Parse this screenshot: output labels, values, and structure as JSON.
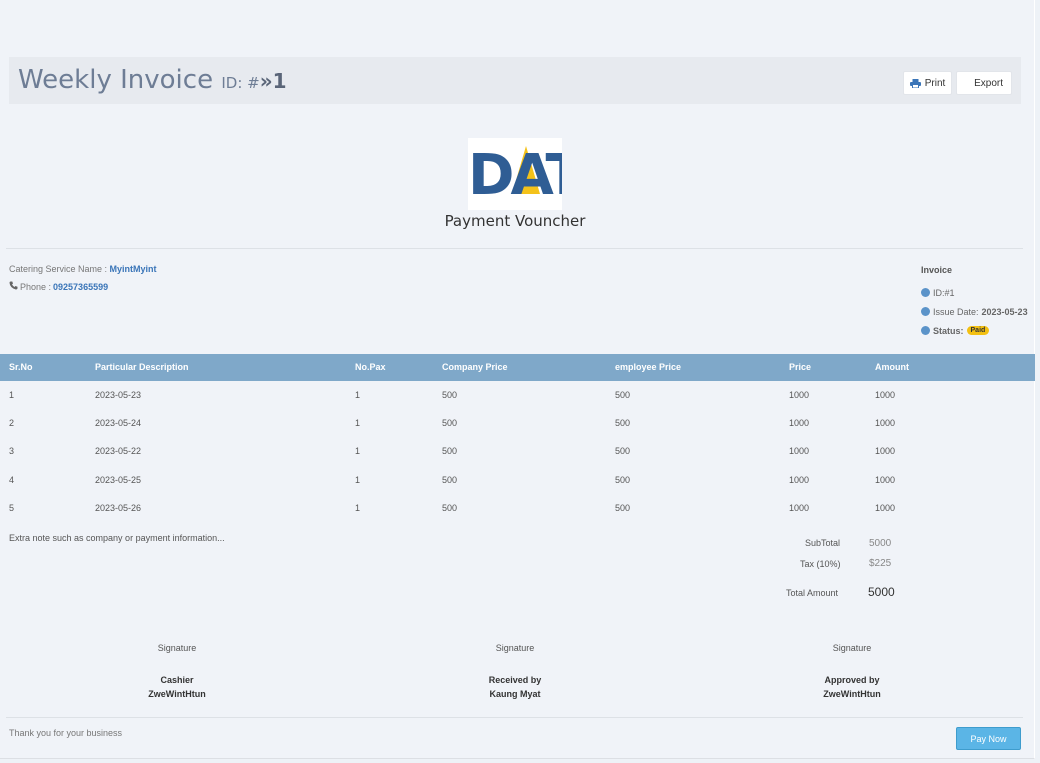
{
  "header": {
    "title": "Weekly Invoice",
    "id_label": "ID: #",
    "id_glyph": "»",
    "id_value": "1",
    "print_label": "Print",
    "export_label": "Export"
  },
  "logo": {
    "text_left": "D",
    "text_mid": "A",
    "text_right": "T",
    "colors": {
      "blue": "#2f5d94",
      "yellow": "#f4c21a"
    }
  },
  "voucher_title": "Payment Vouncher",
  "caterer": {
    "name_label": "Catering Service Name : ",
    "name": "MyintMyint",
    "phone_label": "Phone : ",
    "phone": "09257365599"
  },
  "invoice": {
    "title": "Invoice",
    "id": "ID:#1",
    "issue_label": "Issue Date: ",
    "issue_date": "2023-05-23",
    "status_label": "Status:",
    "status": "Paid"
  },
  "table": {
    "headers": [
      "Sr.No",
      "Particular Description",
      "No.Pax",
      "Company Price",
      "employee Price",
      "Price",
      "Amount"
    ],
    "rows": [
      [
        "1",
        "2023-05-23",
        "1",
        "500",
        "500",
        "1000",
        "1000"
      ],
      [
        "2",
        "2023-05-24",
        "1",
        "500",
        "500",
        "1000",
        "1000"
      ],
      [
        "3",
        "2023-05-22",
        "1",
        "500",
        "500",
        "1000",
        "1000"
      ],
      [
        "4",
        "2023-05-25",
        "1",
        "500",
        "500",
        "1000",
        "1000"
      ],
      [
        "5",
        "2023-05-26",
        "1",
        "500",
        "500",
        "1000",
        "1000"
      ]
    ]
  },
  "note": "Extra note such as company or payment information...",
  "totals": {
    "subtotal_label": "SubTotal",
    "subtotal": "5000",
    "tax_label": "Tax (10%)",
    "tax": "$225",
    "total_label": "Total Amount",
    "total": "5000"
  },
  "signatures": [
    {
      "label": "Signature",
      "role": "Cashier",
      "name": "ZweWintHtun"
    },
    {
      "label": "Signature",
      "role": "Received by",
      "name": "Kaung Myat"
    },
    {
      "label": "Signature",
      "role": "Approved by",
      "name": "ZweWintHtun"
    }
  ],
  "footer": {
    "thanks": "Thank you for your business",
    "pay_label": "Pay Now"
  },
  "colors": {
    "table_header": "#7fa8c9",
    "paid_badge": "#f3c012",
    "pay_button": "#5bb5e6",
    "link": "#3a75b8"
  }
}
